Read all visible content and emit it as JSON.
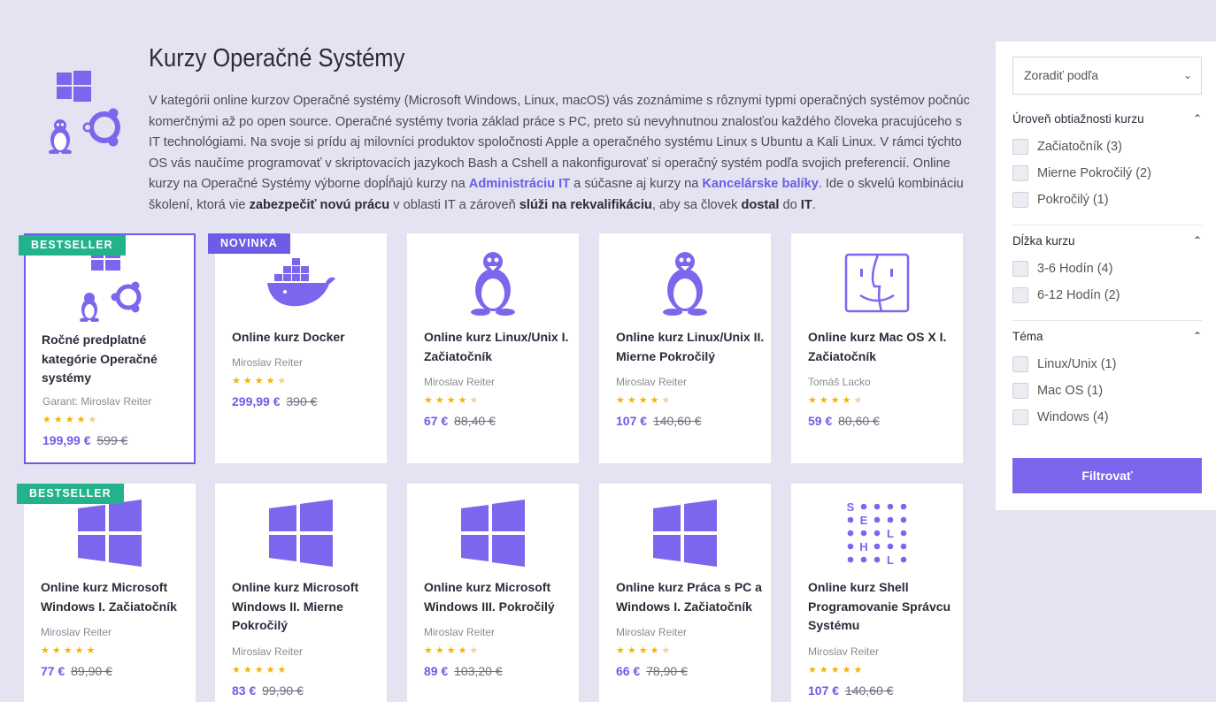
{
  "page": {
    "title": "Kurzy Operačné Systémy",
    "desc": {
      "t1": "V kategórii online kurzov Operačné systémy (Microsoft Windows, Linux, macOS) vás zoznámime s rôznymi typmi operačných systémov počnúc komerčnými až po open source. Operačné systémy tvoria základ práce s PC, preto sú nevyhnutnou znalosťou každého človeka pracujúceho s IT technológiami.  Na svoje si prídu aj milovníci produktov spoločnosti Apple a operačného systému Linux s Ubuntu a Kali Linux. V rámci týchto OS vás naučíme programovať v skriptovacích jazykoch Bash a Cshell a nakonfigurovať si operačný systém podľa svojich preferencií. Online kurzy na Operačné Systémy výborne dopĺňajú kurzy na ",
      "link1": "Administráciu IT",
      "t2": " a súčasne aj kurzy na ",
      "link2": "Kancelárske balíky",
      "t3": ". Ide o skvelú kombináciu školení, ktorá vie ",
      "b1": "zabezpečiť novú prácu",
      "t4": " v oblasti IT a zároveň ",
      "b2": "slúži na rekvalifikáciu",
      "t5": ", aby sa človek ",
      "b3": "dostal",
      "t6": " do ",
      "b4": "IT",
      "t7": "."
    }
  },
  "colors": {
    "accent": "#6e5ce6",
    "bestseller": "#22b38c",
    "star": "#f5b400"
  },
  "cards": [
    {
      "badge": "BESTSELLER",
      "icon": "os-combo-icon",
      "name": "Ročné predplatné kategórie Operačné systémy",
      "author": "Garant: Miroslav Reiter",
      "rating": 4.5,
      "price": "199,99 €",
      "old": "599 €"
    },
    {
      "badge": "NOVINKA",
      "icon": "docker-icon",
      "name": "Online kurz Docker",
      "author": "Miroslav Reiter",
      "rating": 4.5,
      "price": "299,99 €",
      "old": "390 €"
    },
    {
      "badge": "",
      "icon": "linux-tux-icon",
      "name": "Online kurz Linux/Unix I. Začiatočník",
      "author": "Miroslav Reiter",
      "rating": 4.5,
      "price": "67 €",
      "old": "88,40 €"
    },
    {
      "badge": "",
      "icon": "linux-tux-icon",
      "name": "Online kurz Linux/Unix II. Mierne Pokročilý",
      "author": "Miroslav Reiter",
      "rating": 4.5,
      "price": "107 €",
      "old": "140,60 €"
    },
    {
      "badge": "",
      "icon": "mac-finder-icon",
      "name": "Online kurz Mac OS X I. Začiatočník",
      "author": "Tomáš Lacko",
      "rating": 4.5,
      "price": "59 €",
      "old": "80,60 €"
    },
    {
      "badge": "BESTSELLER",
      "icon": "windows-icon",
      "name": "Online kurz Microsoft Windows I. Začiatočník",
      "author": "Miroslav Reiter",
      "rating": 5,
      "price": "77 €",
      "old": "89,90 €"
    },
    {
      "badge": "",
      "icon": "windows-icon",
      "name": "Online kurz Microsoft Windows II. Mierne Pokročilý",
      "author": "Miroslav Reiter",
      "rating": 5,
      "price": "83 €",
      "old": "99,90 €"
    },
    {
      "badge": "",
      "icon": "windows-icon",
      "name": "Online kurz Microsoft Windows III. Pokročilý",
      "author": "Miroslav Reiter",
      "rating": 4.5,
      "price": "89 €",
      "old": "103,20 €"
    },
    {
      "badge": "",
      "icon": "windows-icon",
      "name": "Online kurz Práca s PC a Windows I. Začiatočník",
      "author": "Miroslav Reiter",
      "rating": 4.5,
      "price": "66 €",
      "old": "78,90 €"
    },
    {
      "badge": "",
      "icon": "shell-icon",
      "name": "Online kurz Shell Programovanie Správcu Systému",
      "author": "Miroslav Reiter",
      "rating": 5,
      "price": "107 €",
      "old": "140,60 €"
    }
  ],
  "filters": {
    "sort_placeholder": "Zoradiť podľa",
    "groups": [
      {
        "title": "Úroveň obtiažnosti kurzu",
        "options": [
          "Začiatočník (3)",
          "Mierne Pokročilý (2)",
          "Pokročilý (1)"
        ]
      },
      {
        "title": "Dĺžka kurzu",
        "options": [
          "3-6 Hodín (4)",
          "6-12 Hodín (2)"
        ]
      },
      {
        "title": "Téma",
        "options": [
          "Linux/Unix (1)",
          "Mac OS (1)",
          "Windows (4)"
        ]
      }
    ],
    "button": "Filtrovať"
  }
}
